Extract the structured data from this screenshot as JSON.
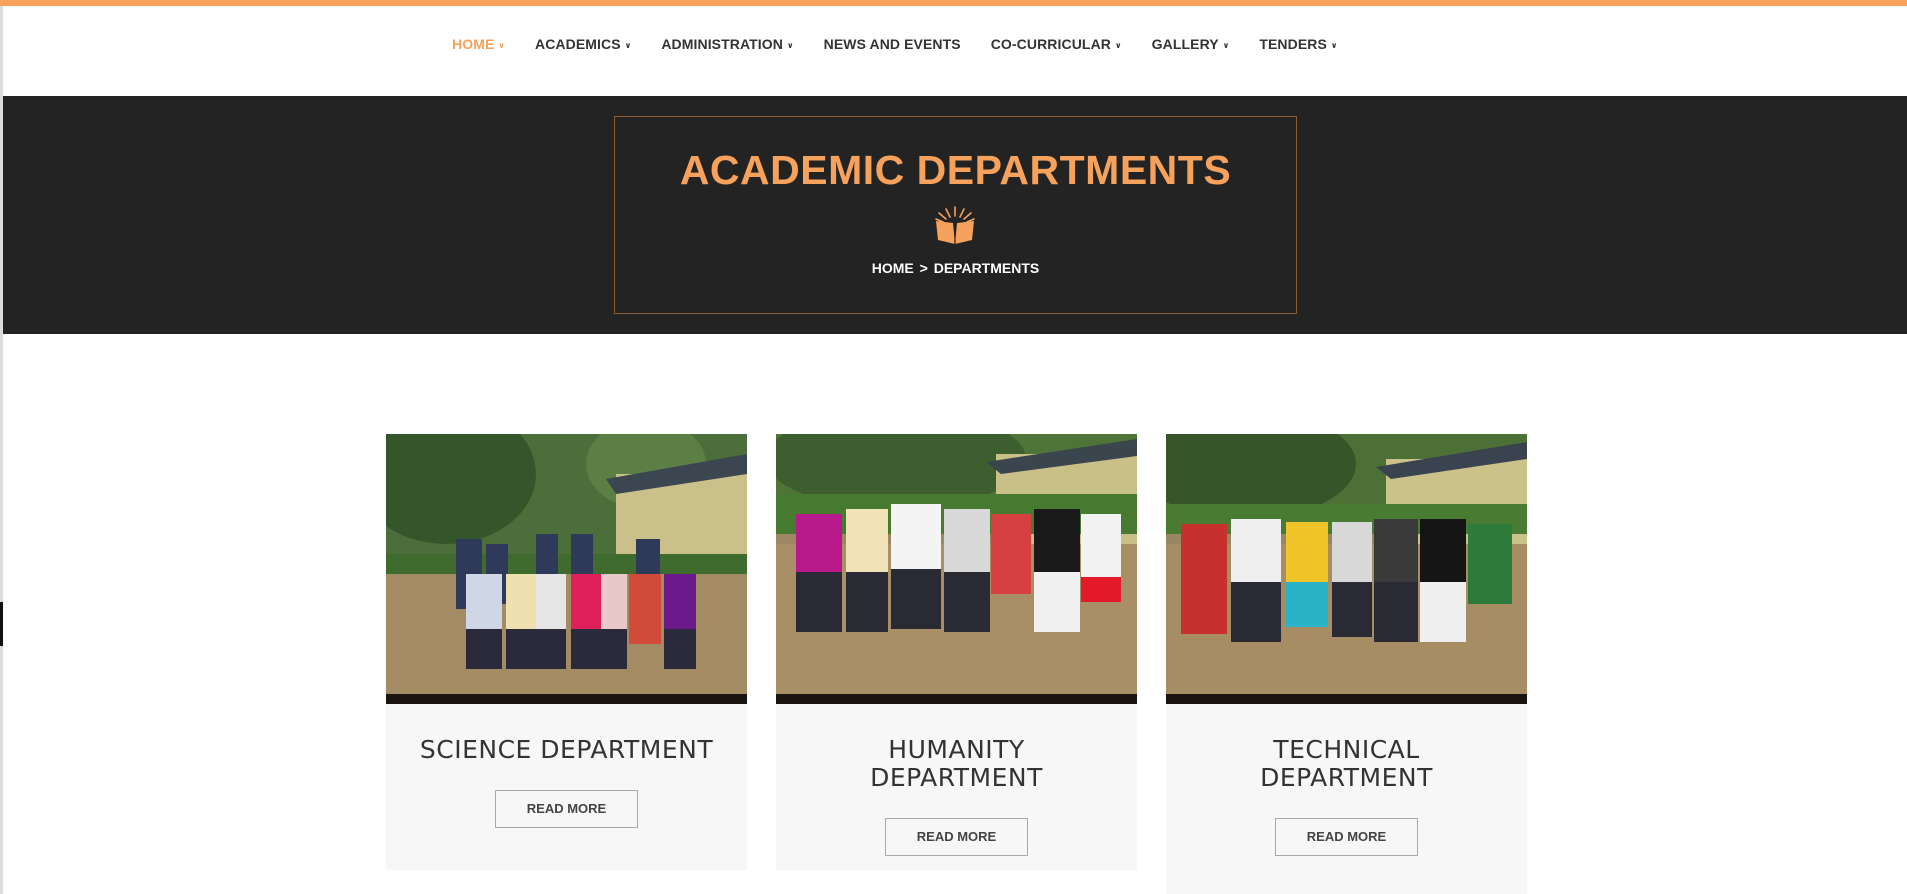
{
  "nav": {
    "items": [
      {
        "label": "HOME",
        "has_dropdown": true,
        "active": true
      },
      {
        "label": "ACADEMICS",
        "has_dropdown": true,
        "active": false
      },
      {
        "label": "ADMINISTRATION",
        "has_dropdown": true,
        "active": false
      },
      {
        "label": "NEWS AND EVENTS",
        "has_dropdown": false,
        "active": false
      },
      {
        "label": "CO-CURRICULAR",
        "has_dropdown": true,
        "active": false
      },
      {
        "label": "GALLERY",
        "has_dropdown": true,
        "active": false
      },
      {
        "label": "TENDERS",
        "has_dropdown": true,
        "active": false
      }
    ]
  },
  "hero": {
    "title": "ACADEMIC DEPARTMENTS",
    "icon": "open-book-icon",
    "breadcrumb": {
      "home": "HOME",
      "separator": ">",
      "current": "DEPARTMENTS"
    }
  },
  "departments": [
    {
      "title": "SCIENCE DEPARTMENT",
      "button": "READ MORE",
      "photo": "group-photo"
    },
    {
      "title": "HUMANITY DEPARTMENT",
      "button": "READ MORE",
      "photo": "group-photo"
    },
    {
      "title": "TECHNICAL DEPARTMENT",
      "button": "READ MORE",
      "photo": "group-photo"
    }
  ],
  "colors": {
    "accent": "#f6a15c",
    "hero_bg": "#232323",
    "card_bg": "#f6f7f6"
  }
}
